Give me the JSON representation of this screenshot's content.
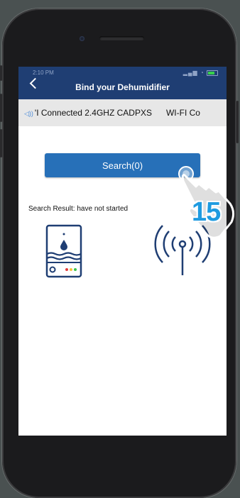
{
  "status_bar": {
    "time": "2:10 PM"
  },
  "header": {
    "title": "Bind your Dehumidifier"
  },
  "marquee": {
    "part1": "'I Connected 2.4GHZ CADPXS",
    "part2": "WI-FI Co"
  },
  "search_button": {
    "label": "Search(0)"
  },
  "search_result": {
    "label": "Search Result: have not started"
  },
  "overlay": {
    "step": "15"
  },
  "icons": {
    "back": "chevron-left-icon",
    "volume": "speaker-icon",
    "device": "dehumidifier-icon",
    "wifi": "wifi-signal-icon",
    "hand": "tap-hand-icon"
  },
  "colors": {
    "header_bg": "#1f3e73",
    "button_bg": "#2770b8",
    "icon_dark": "#1f3e73",
    "step_number": "#1f9be0"
  }
}
